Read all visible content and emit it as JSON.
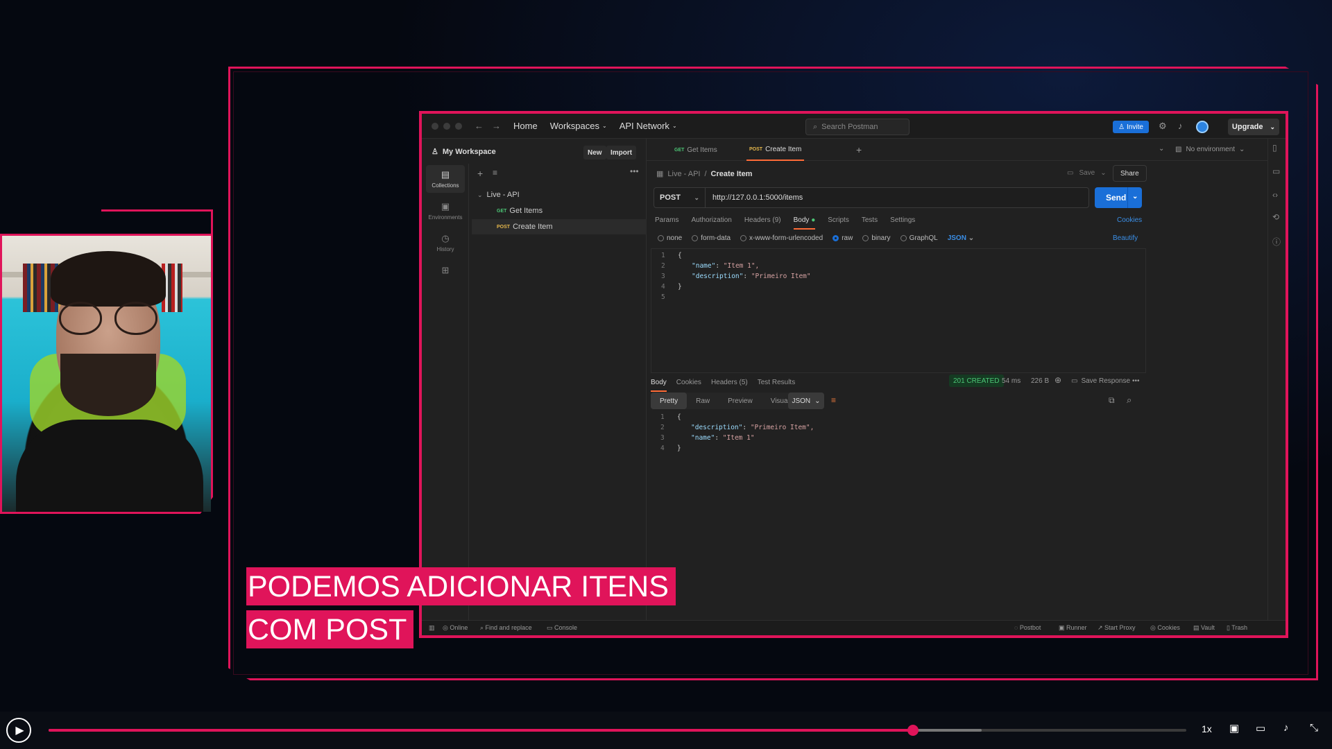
{
  "overlay": {
    "caption_line1": "PODEMOS ADICIONAR ITENS",
    "caption_line2": "COM POST"
  },
  "app": {
    "nav": {
      "home": "Home",
      "workspaces": "Workspaces",
      "api_network": "API Network"
    },
    "search_placeholder": "Search Postman",
    "invite": "Invite",
    "upgrade": "Upgrade",
    "workspace_name": "My Workspace",
    "new_btn": "New",
    "import_btn": "Import",
    "rail": [
      {
        "label": "Collections",
        "icon": "collections-icon"
      },
      {
        "label": "Environments",
        "icon": "environments-icon"
      },
      {
        "label": "History",
        "icon": "history-icon"
      },
      {
        "label": "",
        "icon": "apps-icon"
      }
    ],
    "tree": {
      "collection": "Live - API",
      "items": [
        {
          "method": "GET",
          "name": "Get Items"
        },
        {
          "method": "POST",
          "name": "Create Item"
        }
      ]
    },
    "tabs": [
      {
        "method": "GET",
        "name": "Get Items"
      },
      {
        "method": "POST",
        "name": "Create Item"
      }
    ],
    "environment": "No environment",
    "breadcrumb": {
      "parent": "Live - API",
      "sep": "/",
      "current": "Create Item"
    },
    "save": "Save",
    "share": "Share",
    "request": {
      "method": "POST",
      "url": "http://127.0.0.1:5000/items",
      "send": "Send"
    },
    "request_tabs": [
      "Params",
      "Authorization",
      "Headers (9)",
      "Body",
      "Scripts",
      "Tests",
      "Settings"
    ],
    "cookies": "Cookies",
    "body_options": [
      "none",
      "form-data",
      "x-www-form-urlencoded",
      "raw",
      "binary",
      "GraphQL"
    ],
    "body_format": "JSON",
    "beautify": "Beautify",
    "request_body": [
      {
        "n": "1",
        "text": "{"
      },
      {
        "n": "2",
        "key": "\"name\"",
        "val": "\"Item 1\","
      },
      {
        "n": "3",
        "key": "\"description\"",
        "val": "\"Primeiro Item\""
      },
      {
        "n": "4",
        "text": "}"
      },
      {
        "n": "5",
        "text": ""
      }
    ],
    "response_tabs": [
      "Body",
      "Cookies",
      "Headers (5)",
      "Test Results"
    ],
    "response_status": "201 CREATED",
    "response_time": "54 ms",
    "response_size": "226 B",
    "save_response": "Save Response",
    "response_formats": [
      "Pretty",
      "Raw",
      "Preview",
      "Visualize"
    ],
    "response_format": "JSON",
    "response_body": [
      {
        "n": "1",
        "text": "{"
      },
      {
        "n": "2",
        "key": "\"description\"",
        "val": "\"Primeiro Item\","
      },
      {
        "n": "3",
        "key": "\"name\"",
        "val": "\"Item 1\""
      },
      {
        "n": "4",
        "text": "}"
      }
    ],
    "statusbar_left": [
      "Online",
      "Find and replace",
      "Console"
    ],
    "statusbar_right": [
      "Postbot",
      "Runner",
      "Start Proxy",
      "Cookies",
      "Vault",
      "Trash"
    ]
  },
  "player": {
    "speed": "1x",
    "progress_percent": 76,
    "buffered_percent": 82
  }
}
